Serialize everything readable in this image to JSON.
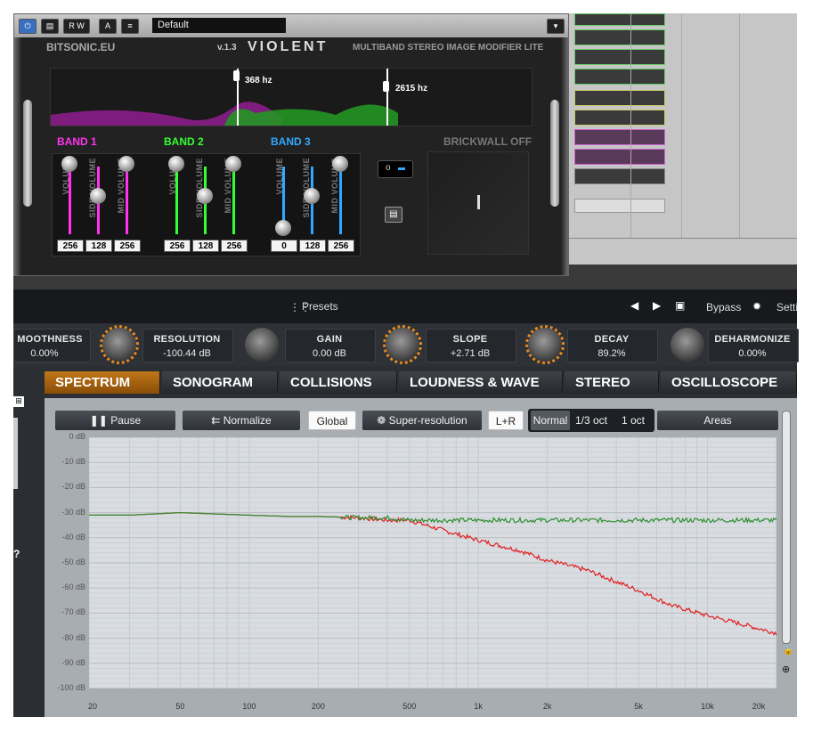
{
  "violent": {
    "preset": "Default",
    "brand": "BITSONIC.EU",
    "version": "v.1.3",
    "logo": "VIOLENT",
    "subtitle": "MULTIBAND STEREO IMAGE MODIFIER LITE",
    "crossover1": "368 hz",
    "crossover2": "2615 hz",
    "brickwall": "BRICKWALL OFF",
    "fader_labels": {
      "volume": "VOLUME",
      "side": "SIDE VOLUME",
      "mid": "MID VOLUME"
    },
    "bands": [
      {
        "name": "BAND 1",
        "color": "#ff33ee",
        "volume": "256",
        "side": "128",
        "mid": "256"
      },
      {
        "name": "BAND 2",
        "color": "#33ff33",
        "volume": "256",
        "side": "128",
        "mid": "256"
      },
      {
        "name": "BAND 3",
        "color": "#2ea8ff",
        "volume": "0",
        "side": "128",
        "mid": "256"
      }
    ]
  },
  "analyzer": {
    "presets": "Presets",
    "bypass": "Bypass",
    "settings": "Setti",
    "knobs": [
      {
        "label": "MOOTHNESS",
        "value": "0.00%"
      },
      {
        "label": "RESOLUTION",
        "value": "-100.44 dB"
      },
      {
        "label": "GAIN",
        "value": "0.00 dB"
      },
      {
        "label": "SLOPE",
        "value": "+2.71 dB"
      },
      {
        "label": "DECAY",
        "value": "89.2%"
      },
      {
        "label": "DEHARMONIZE",
        "value": "0.00%"
      }
    ],
    "tabs": [
      "SPECTRUM",
      "SONOGRAM",
      "COLLISIONS",
      "LOUDNESS & WAVE",
      "STEREO",
      "OSCILLOSCOPE"
    ],
    "toolbar": {
      "pause": "Pause",
      "normalize": "Normalize",
      "global": "Global",
      "superres": "Super-resolution",
      "lr": "L+R",
      "normal": "Normal",
      "third_oct": "1/3 oct",
      "one_oct": "1 oct",
      "areas": "Areas"
    },
    "colors": {
      "accent": "#e88a1e",
      "series_red": "#e02020",
      "series_green": "#2f8f2f"
    }
  },
  "chart_data": {
    "type": "line",
    "xlabel": "",
    "ylabel": "",
    "x_scale": "log",
    "xlim": [
      20,
      20000
    ],
    "ylim": [
      -100,
      0
    ],
    "x_ticks": [
      "20",
      "50",
      "100",
      "200",
      "500",
      "1k",
      "2k",
      "5k",
      "10k",
      "20k"
    ],
    "y_ticks": [
      "0 dB",
      "-10 dB",
      "-20 dB",
      "-30 dB",
      "-40 dB",
      "-50 dB",
      "-60 dB",
      "-70 dB",
      "-80 dB",
      "-90 dB",
      "-100 dB"
    ],
    "grid": true,
    "x": [
      20,
      30,
      50,
      70,
      100,
      150,
      200,
      300,
      400,
      500,
      700,
      1000,
      1500,
      2000,
      3000,
      5000,
      7000,
      10000,
      15000,
      20000
    ],
    "series": [
      {
        "color": "#e02020",
        "values": [
          -31,
          -31,
          -30,
          -30.5,
          -31,
          -31.5,
          -31.5,
          -32,
          -33,
          -33,
          -37,
          -41,
          -45,
          -49,
          -53,
          -61,
          -67,
          -71,
          -75,
          -78
        ]
      },
      {
        "color": "#2f8f2f",
        "values": [
          -31,
          -31,
          -30,
          -30.5,
          -31,
          -31.5,
          -31.5,
          -32,
          -32,
          -33,
          -33,
          -33,
          -33,
          -33,
          -33,
          -33,
          -33,
          -33,
          -33,
          -33
        ]
      }
    ]
  }
}
